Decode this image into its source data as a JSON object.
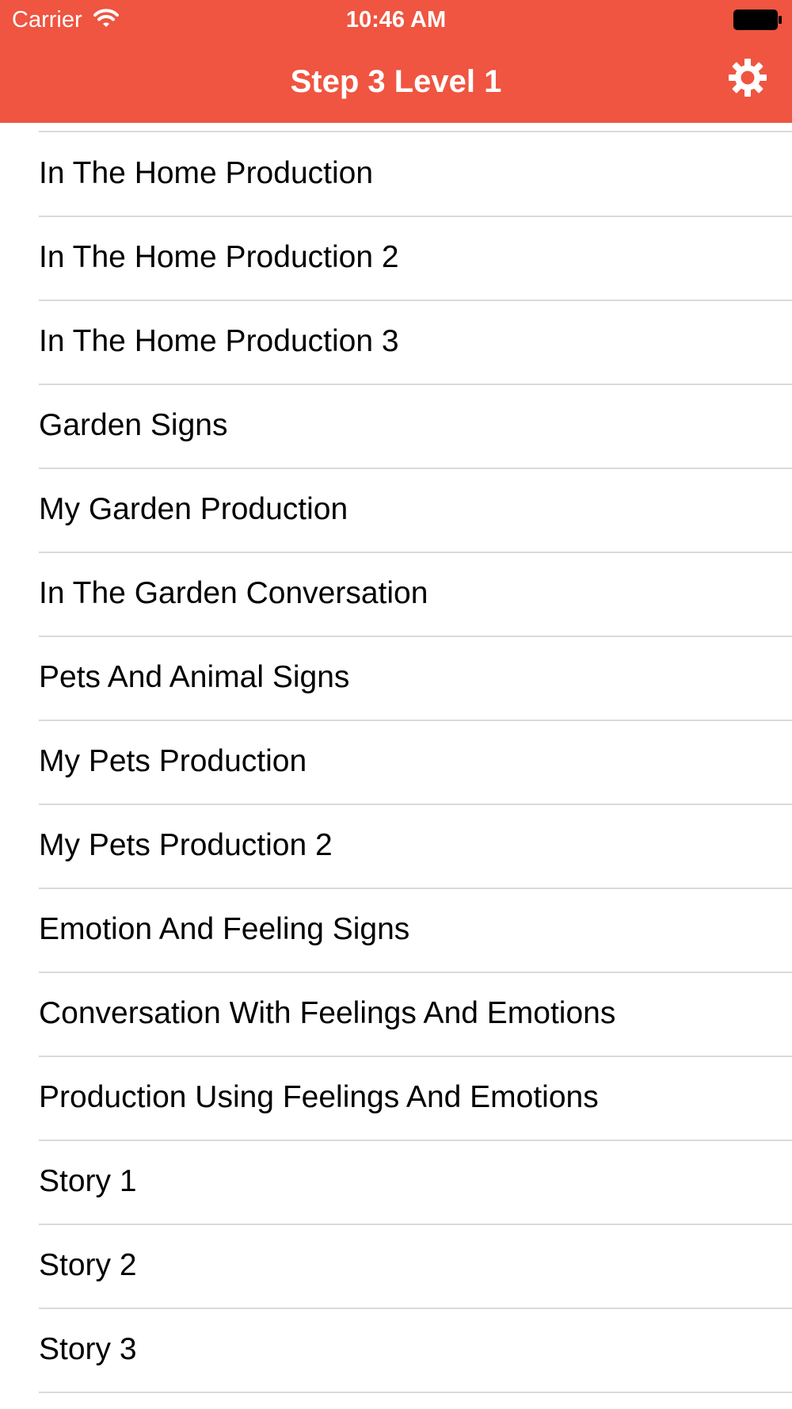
{
  "status_bar": {
    "carrier": "Carrier",
    "time": "10:46 AM",
    "wifi_icon": "wifi-icon",
    "battery_icon": "battery-icon"
  },
  "nav": {
    "title": "Step 3 Level 1",
    "settings_icon": "gear-icon",
    "background_color": "#ef5540"
  },
  "list": {
    "items": [
      {
        "label": "In The Home Production"
      },
      {
        "label": "In The Home Production 2"
      },
      {
        "label": "In The Home Production 3"
      },
      {
        "label": "Garden Signs"
      },
      {
        "label": "My Garden Production"
      },
      {
        "label": "In The Garden Conversation"
      },
      {
        "label": "Pets And Animal Signs"
      },
      {
        "label": "My Pets Production"
      },
      {
        "label": "My Pets Production 2"
      },
      {
        "label": "Emotion And Feeling Signs"
      },
      {
        "label": "Conversation With Feelings And Emotions"
      },
      {
        "label": "Production Using Feelings And Emotions"
      },
      {
        "label": "Story 1"
      },
      {
        "label": "Story 2"
      },
      {
        "label": "Story 3"
      }
    ]
  }
}
